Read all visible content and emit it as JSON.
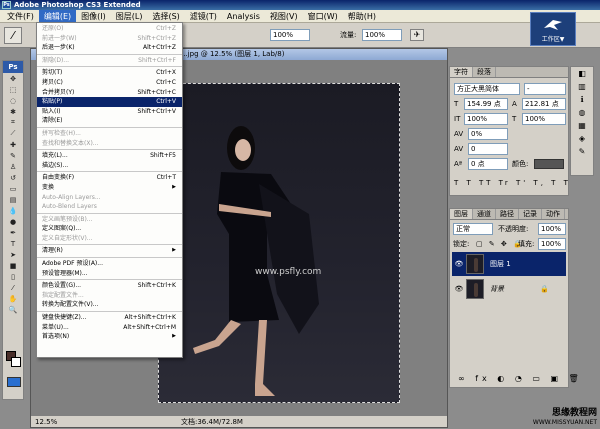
{
  "titlebar": {
    "title": "Adobe Photoshop CS3 Extended"
  },
  "menubar": {
    "items": [
      "文件(F)",
      "编辑(E)",
      "图像(I)",
      "图层(L)",
      "选择(S)",
      "滤镜(T)",
      "Analysis",
      "视图(V)",
      "窗口(W)",
      "帮助(H)"
    ]
  },
  "options": {
    "zoom1": "100%",
    "zoom2": "100%",
    "flow_label": "流量:",
    "mode_label": "100%"
  },
  "document": {
    "title": "...jpg @ 12.5% (图层 1, Lab/8)",
    "watermark": "www.psfly.com",
    "zoom": "12.5%",
    "docinfo": "文档:36.4M/72.8M"
  },
  "menu": {
    "items": [
      {
        "label": "还原(O)",
        "shortcut": "Ctrl+Z",
        "disabled": true
      },
      {
        "label": "前进一步(W)",
        "shortcut": "Shift+Ctrl+Z",
        "disabled": true
      },
      {
        "label": "后退一步(K)",
        "shortcut": "Alt+Ctrl+Z",
        "disabled": false
      },
      {
        "sep": true
      },
      {
        "label": "渐隐(D)...",
        "shortcut": "Shift+Ctrl+F",
        "disabled": true
      },
      {
        "sep": true
      },
      {
        "label": "剪切(T)",
        "shortcut": "Ctrl+X",
        "disabled": false
      },
      {
        "label": "拷贝(C)",
        "shortcut": "Ctrl+C",
        "disabled": false
      },
      {
        "label": "合并拷贝(Y)",
        "shortcut": "Shift+Ctrl+C",
        "disabled": false
      },
      {
        "label": "粘贴(P)",
        "shortcut": "Ctrl+V",
        "disabled": false,
        "selected": true
      },
      {
        "label": "贴入(I)",
        "shortcut": "Shift+Ctrl+V",
        "disabled": false
      },
      {
        "label": "清除(E)",
        "shortcut": "",
        "disabled": false
      },
      {
        "sep": true
      },
      {
        "label": "拼写检查(H)...",
        "shortcut": "",
        "disabled": true
      },
      {
        "label": "查找和替换文本(X)...",
        "shortcut": "",
        "disabled": true
      },
      {
        "sep": true
      },
      {
        "label": "填充(L)...",
        "shortcut": "Shift+F5",
        "disabled": false
      },
      {
        "label": "描边(S)...",
        "shortcut": "",
        "disabled": false
      },
      {
        "sep": true
      },
      {
        "label": "自由变换(F)",
        "shortcut": "Ctrl+T",
        "disabled": false
      },
      {
        "label": "变换",
        "shortcut": "",
        "disabled": false,
        "submenu": true
      },
      {
        "label": "Auto-Align Layers...",
        "shortcut": "",
        "disabled": true
      },
      {
        "label": "Auto-Blend Layers",
        "shortcut": "",
        "disabled": true
      },
      {
        "sep": true
      },
      {
        "label": "定义画笔预设(B)...",
        "shortcut": "",
        "disabled": true
      },
      {
        "label": "定义图案(Q)...",
        "shortcut": "",
        "disabled": false
      },
      {
        "label": "定义自定形状(V)...",
        "shortcut": "",
        "disabled": true
      },
      {
        "sep": true
      },
      {
        "label": "清理(R)",
        "shortcut": "",
        "disabled": false,
        "submenu": true
      },
      {
        "sep": true
      },
      {
        "label": "Adobe PDF 预设(A)...",
        "shortcut": "",
        "disabled": false
      },
      {
        "label": "预设管理器(M)...",
        "shortcut": "",
        "disabled": false
      },
      {
        "sep": true
      },
      {
        "label": "颜色设置(G)...",
        "shortcut": "Shift+Ctrl+K",
        "disabled": false
      },
      {
        "label": "指定配置文件...",
        "shortcut": "",
        "disabled": true
      },
      {
        "label": "转换为配置文件(V)...",
        "shortcut": "",
        "disabled": false
      },
      {
        "sep": true
      },
      {
        "label": "键盘快捷键(Z)...",
        "shortcut": "Alt+Shift+Ctrl+K",
        "disabled": false
      },
      {
        "label": "菜单(U)...",
        "shortcut": "Alt+Shift+Ctrl+M",
        "disabled": false
      },
      {
        "label": "首选项(N)",
        "shortcut": "",
        "disabled": false,
        "submenu": true
      }
    ]
  },
  "char_panel": {
    "tabs": [
      "字符",
      "段落"
    ],
    "font": "方正大黑简体",
    "font_style": "-",
    "size": "154.99 点",
    "leading": "212.81 点",
    "vscale": "100%",
    "hscale": "100%",
    "tracking": "0%",
    "kerning": "0",
    "baseline": "0 点",
    "color_label": "颜色:"
  },
  "layers_panel": {
    "tabs": [
      "图层",
      "通道",
      "路径",
      "记录",
      "动作"
    ],
    "blend_mode": "正常",
    "opacity_label": "不透明度:",
    "opacity": "100%",
    "lock_label": "锁定:",
    "fill_label": "填充:",
    "fill": "100%",
    "layers": [
      {
        "name": "图层 1",
        "selected": true
      },
      {
        "name": "背景",
        "selected": false
      }
    ]
  },
  "logo": {
    "text": "工作区▼"
  },
  "footer": {
    "line1": "思缘教程网",
    "line2": "WWW.MISSYUAN.NET"
  }
}
